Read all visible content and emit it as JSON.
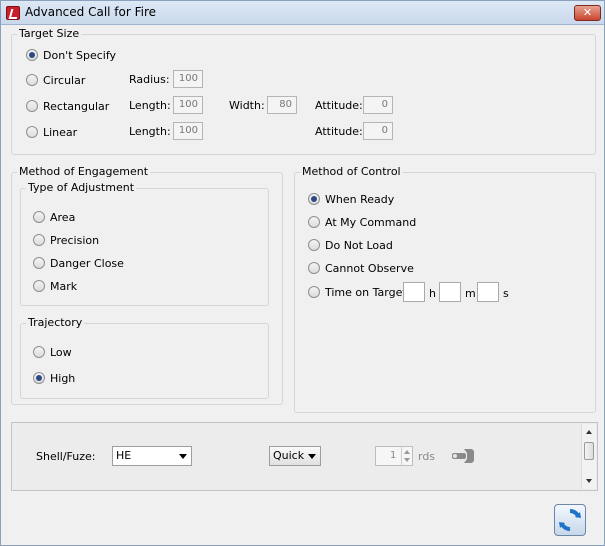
{
  "window": {
    "title": "Advanced Call for Fire",
    "close_label": "✕"
  },
  "target_size": {
    "legend": "Target Size",
    "options": {
      "dont_specify": "Don't Specify",
      "circular": "Circular",
      "rectangular": "Rectangular",
      "linear": "Linear"
    },
    "selected": "dont_specify",
    "radius_label": "Radius:",
    "radius_value": "100",
    "rect_length_label": "Length:",
    "rect_length_value": "100",
    "width_label": "Width:",
    "width_value": "80",
    "rect_attitude_label": "Attitude:",
    "rect_attitude_value": "0",
    "linear_length_label": "Length:",
    "linear_length_value": "100",
    "linear_attitude_label": "Attitude:",
    "linear_attitude_value": "0"
  },
  "method_of_engagement": {
    "legend": "Method of Engagement",
    "type_of_adjustment": {
      "legend": "Type of Adjustment",
      "options": [
        "Area",
        "Precision",
        "Danger Close",
        "Mark"
      ]
    },
    "trajectory": {
      "legend": "Trajectory",
      "options": [
        "Low",
        "High"
      ],
      "selected": "High"
    }
  },
  "method_of_control": {
    "legend": "Method of Control",
    "options": [
      "When Ready",
      "At My Command",
      "Do Not Load",
      "Cannot Observe",
      "Time on Target"
    ],
    "selected": "When Ready",
    "time_units": {
      "h": "h",
      "m": "m",
      "s": "s"
    }
  },
  "munitions": {
    "shell_fuze_label": "Shell/Fuze:",
    "shell_value": "HE",
    "fuze_value": "Quick",
    "rounds_value": "1",
    "rounds_unit": "rds"
  },
  "icons": {
    "app": "app-icon",
    "close": "close-icon",
    "configure": "wrench-icon",
    "refresh": "refresh-icon"
  },
  "colors": {
    "selected_radio": "#2b4a86",
    "refresh_accent": "#1e73c8",
    "close_button": "#c9452f"
  }
}
